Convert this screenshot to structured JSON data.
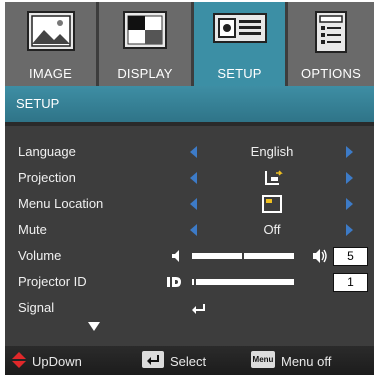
{
  "tabs": [
    {
      "label": "IMAGE",
      "icon": "image-icon",
      "active": false
    },
    {
      "label": "DISPLAY",
      "icon": "display-icon",
      "active": false
    },
    {
      "label": "SETUP",
      "icon": "setup-icon",
      "active": true
    },
    {
      "label": "OPTIONS",
      "icon": "options-icon",
      "active": false
    }
  ],
  "menu_title": "SETUP",
  "rows": {
    "language": {
      "label": "Language",
      "value": "English"
    },
    "projection": {
      "label": "Projection",
      "value_icon": "projection-icon"
    },
    "menu_location": {
      "label": "Menu Location",
      "value_icon": "menu-location-icon"
    },
    "mute": {
      "label": "Mute",
      "value": "Off"
    },
    "volume": {
      "label": "Volume",
      "value": "5",
      "level": 0.5
    },
    "projector_id": {
      "label": "Projector ID",
      "value": "1",
      "level": 0.02
    },
    "signal": {
      "label": "Signal",
      "value_icon": "enter-icon"
    }
  },
  "footer": {
    "updown": "UpDown",
    "select": "Select",
    "menu_key": "Menu",
    "menu_off": "Menu off"
  },
  "colors": {
    "panel": "#3d3d3d",
    "tab_inactive": "#6a6a6a",
    "tab_active": "#3c8fa5",
    "arrow": "#3d7bc7",
    "updown_key": "#e0282a"
  }
}
